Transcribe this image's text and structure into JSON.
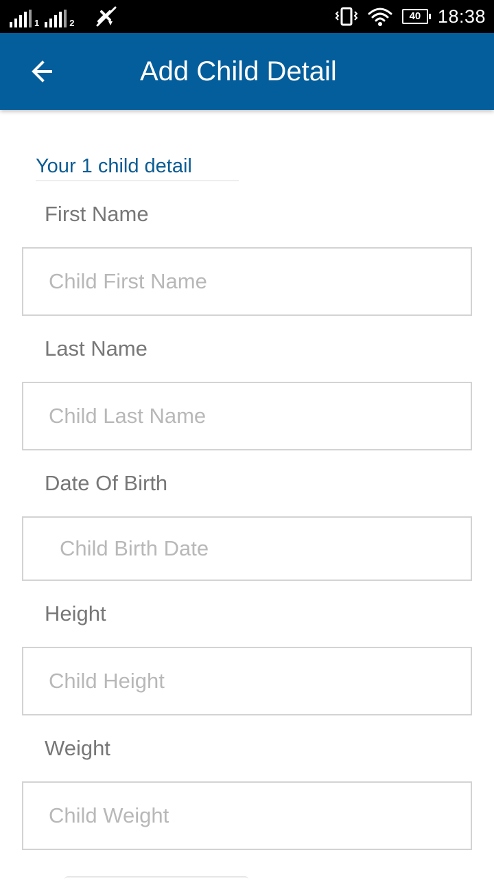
{
  "status_bar": {
    "sim1_label": "1",
    "sim2_label": "2",
    "battery_level": "40",
    "time": "18:38",
    "icons": [
      "signal-icon",
      "signal-icon",
      "no-sync-icon",
      "vibrate-icon",
      "wifi-icon",
      "battery-icon"
    ]
  },
  "app_bar": {
    "title": "Add Child Detail",
    "back_icon": "arrow-left-icon",
    "color": "#035e9b"
  },
  "form": {
    "section_title": "Your 1 child detail",
    "fields": [
      {
        "label": "First Name",
        "placeholder": "Child First Name",
        "value": ""
      },
      {
        "label": "Last Name",
        "placeholder": "Child Last Name",
        "value": ""
      },
      {
        "label": "Date Of Birth",
        "placeholder": "Child Birth Date",
        "value": ""
      },
      {
        "label": "Height",
        "placeholder": "Child Height",
        "value": ""
      },
      {
        "label": "Weight",
        "placeholder": "Child Weight",
        "value": ""
      }
    ]
  },
  "colors": {
    "accent": "#0a5c93",
    "label": "#777777",
    "placeholder": "#b8b8b8",
    "border": "#d3d3d3"
  }
}
